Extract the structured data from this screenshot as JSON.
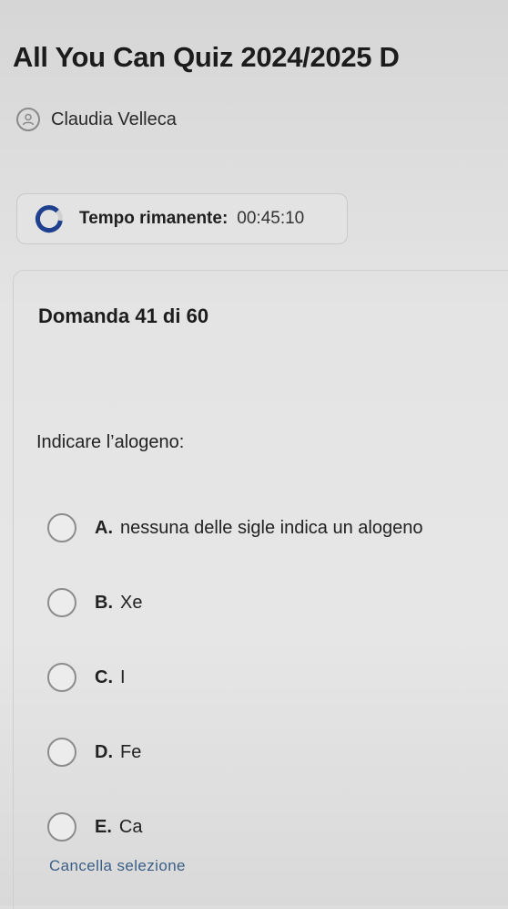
{
  "quiz": {
    "title": "All You Can Quiz 2024/2025 D"
  },
  "user": {
    "name": "Claudia Velleca",
    "avatar_icon": "user-avatar-icon"
  },
  "timer": {
    "icon": "timer-progress-icon",
    "label": "Tempo rimanente:",
    "value": "00:45:10"
  },
  "question": {
    "number_label": "Domanda 41 di 60",
    "text": "Indicare l’alogeno:",
    "options": [
      {
        "letter": "A.",
        "text": "nessuna delle sigle indica un alogeno"
      },
      {
        "letter": "B.",
        "text": "Xe"
      },
      {
        "letter": "C.",
        "text": "I"
      },
      {
        "letter": "D.",
        "text": "Fe"
      },
      {
        "letter": "E.",
        "text": "Ca"
      }
    ],
    "clear_selection_label": "Cancella selezione"
  },
  "colors": {
    "link": "#3a5f86",
    "text": "#1d1d1d",
    "radio_border": "#8c8c8c"
  }
}
